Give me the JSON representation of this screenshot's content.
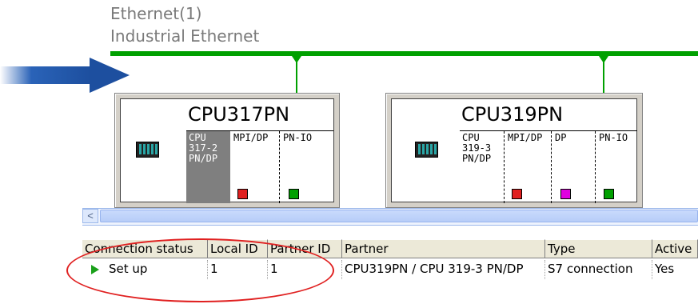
{
  "network": {
    "name": "Ethernet(1)",
    "type": "Industrial Ethernet",
    "bus_color": "#00a000"
  },
  "arrow": {
    "color": "#1d4f9f"
  },
  "stations": [
    {
      "name": "CPU317PN",
      "cpu_lines": [
        "CPU",
        "317-2",
        "PN/DP"
      ],
      "cpu_selected": true,
      "slots": [
        {
          "label": "MPI/DP",
          "color": "#e02020"
        },
        {
          "label": "PN-IO",
          "color": "#00a000"
        }
      ]
    },
    {
      "name": "CPU319PN",
      "cpu_lines": [
        "CPU",
        "319-3",
        "PN/DP"
      ],
      "cpu_selected": false,
      "slots": [
        {
          "label": "MPI/DP",
          "color": "#e02020"
        },
        {
          "label": "DP",
          "color": "#e000e0"
        },
        {
          "label": "PN-IO",
          "color": "#00a000"
        }
      ]
    }
  ],
  "scrollbar": {
    "left_arrow": "<"
  },
  "connection_table": {
    "columns": [
      "Connection status",
      "Local ID",
      "Partner ID",
      "Partner",
      "Type",
      "Active"
    ],
    "rows": [
      {
        "status_icon": "play-icon",
        "status": "Set up",
        "local_id": "1",
        "partner_id": "1",
        "partner": "CPU319PN / CPU 319-3 PN/DP",
        "type": "S7 connection",
        "active": "Yes"
      }
    ]
  },
  "highlight": {
    "color": "#e02020"
  }
}
